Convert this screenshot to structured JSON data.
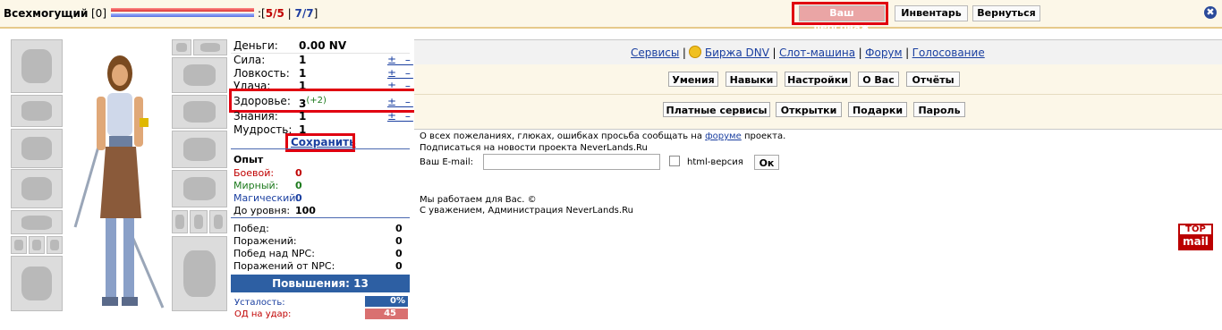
{
  "header": {
    "name": "Всехмогущий",
    "level": "[0]",
    "hp_open": ":[",
    "hp_current": "5",
    "hp_slash": "/",
    "hp_max": "5",
    "hp_sep": "|",
    "mp_current": "7",
    "mp_slash": "/",
    "mp_max": "7",
    "close": "]",
    "btn_character": "Ваш персонаж",
    "btn_inventory": "Инвентарь",
    "btn_back": "Вернуться",
    "close_icon": "✖"
  },
  "stats": {
    "money_label": "Деньги:",
    "money_value": "0.00 NV",
    "strength_label": "Сила:",
    "strength_value": "1",
    "agility_label": "Ловкость:",
    "agility_value": "1",
    "luck_label": "Удача:",
    "luck_value": "1",
    "health_label": "Здоровье:",
    "health_value": "3",
    "health_bonus": "(+2)",
    "knowledge_label": "Знания:",
    "knowledge_value": "1",
    "wisdom_label": "Мудрость:",
    "wisdom_value": "1",
    "pm": "± –",
    "save": "Сохранить"
  },
  "experience": {
    "title": "Опыт",
    "combat_label": "Боевой:",
    "combat_value": "0",
    "peaceful_label": "Мирный:",
    "peaceful_value": "0",
    "magic_label": "Магический:",
    "magic_value": "0",
    "to_level_label": "До уровня:",
    "to_level_value": "100"
  },
  "wins": {
    "wins_label": "Побед:",
    "wins_value": "0",
    "losses_label": "Поражений:",
    "losses_value": "0",
    "npc_wins_label": "Побед над NPC:",
    "npc_wins_value": "0",
    "npc_losses_label": "Поражений от NPC:",
    "npc_losses_value": "0"
  },
  "promotions": "Повышения: 13",
  "fatigue_label": "Усталость:",
  "fatigue_value": "0%",
  "od_label": "ОД на удар:",
  "od_value": "45",
  "nav": {
    "services": "Сервисы",
    "sep": "|",
    "exchange": "Биржа DNV",
    "slot": "Слот-машина",
    "forum": "Форум",
    "vote": "Голосование"
  },
  "row1": [
    "Умения",
    "Навыки",
    "Настройки",
    "О Вас",
    "Отчёты"
  ],
  "row2": [
    "Платные сервисы",
    "Открытки",
    "Подарки",
    "Пароль"
  ],
  "info": {
    "line1_a": "О всех пожеланиях, глюках, ошибках просьба сообщать на ",
    "line1_link": "форуме",
    "line1_b": " проекта.",
    "line2": "Подписаться на новости проекта NeverLands.Ru",
    "email_label": "Ваш E-mail:",
    "html_version": "html-версия",
    "ok": "Ок",
    "work": "Мы работаем для Вас. ©",
    "regards": "С уважением, Администрация NeverLands.Ru"
  },
  "topmail": {
    "top": "TOP",
    "mail": "mail"
  }
}
